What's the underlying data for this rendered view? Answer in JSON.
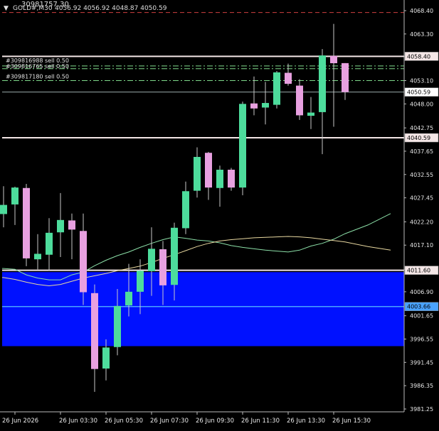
{
  "header": {
    "arrow": "▼",
    "symbol": "GOLD#,M30",
    "ohlc": "4056.92 4056.92 4048.87 4050.59",
    "top_partial": "30981757.30"
  },
  "colors": {
    "background": "#000000",
    "bull_body": "#4ddc9c",
    "bear_body": "#e8a0e0",
    "wick": "#c8c8c8",
    "zone_fill": "#0011ff",
    "ma_short": "#8ce0a8",
    "ma_long": "#e8d8a0",
    "level_white": "#f4e6e6",
    "level_blue": "#4aa3ff",
    "order_line": "#7fd98a",
    "top_dash": "#d04040"
  },
  "order_labels": [
    {
      "text": "#309816988 sell 0.50"
    },
    {
      "text": "#309816765 sell 0.50"
    },
    {
      "text": "#309817180 sell 0.50"
    }
  ],
  "price_boxes": {
    "resistance_upper": "4058.40",
    "current": "4050.59",
    "resistance_lower": "4040.59",
    "support": "4011.60",
    "zone_mid": "4003.66"
  },
  "chart_data": {
    "type": "candlestick",
    "ylim": [
      3981.25,
      4068.4
    ],
    "price_ticks": [
      "4068.40",
      "4063.30",
      "4058.40",
      "4053.10",
      "4048.00",
      "4042.75",
      "4037.65",
      "4032.55",
      "4027.45",
      "4022.20",
      "4017.10",
      "4011.80",
      "4006.90",
      "4001.65",
      "3996.55",
      "3991.45",
      "3986.35",
      "3981.25"
    ],
    "time_labels": [
      {
        "text": "26 Jun 2026",
        "index": 1
      },
      {
        "text": "26 Jun 03:30",
        "index": 5
      },
      {
        "text": "26 Jun 05:30",
        "index": 9
      },
      {
        "text": "26 Jun 07:30",
        "index": 13
      },
      {
        "text": "26 Jun 09:30",
        "index": 17
      },
      {
        "text": "26 Jun 11:30",
        "index": 21
      },
      {
        "text": "26 Jun 13:30",
        "index": 25
      },
      {
        "text": "26 Jun 15:30",
        "index": 29
      }
    ],
    "candles": [
      {
        "o": 4023.9,
        "h": 4030.0,
        "l": 4021.0,
        "c": 4025.9
      },
      {
        "o": 4026.0,
        "h": 4029.9,
        "l": 4021.5,
        "c": 4029.7
      },
      {
        "o": 4029.6,
        "h": 4030.5,
        "l": 4012.5,
        "c": 4014.2
      },
      {
        "o": 4014.0,
        "h": 4019.5,
        "l": 4011.8,
        "c": 4015.2
      },
      {
        "o": 4015.0,
        "h": 4023.0,
        "l": 4011.5,
        "c": 4019.8
      },
      {
        "o": 4019.9,
        "h": 4028.5,
        "l": 4014.5,
        "c": 4022.6
      },
      {
        "o": 4022.5,
        "h": 4024.0,
        "l": 4014.0,
        "c": 4020.5
      },
      {
        "o": 4020.2,
        "h": 4024.0,
        "l": 4004.0,
        "c": 4006.8
      },
      {
        "o": 4006.6,
        "h": 4008.5,
        "l": 3985.0,
        "c": 3990.0
      },
      {
        "o": 3990.1,
        "h": 3996.5,
        "l": 3987.5,
        "c": 3994.7
      },
      {
        "o": 3994.8,
        "h": 4007.5,
        "l": 3993.0,
        "c": 4003.8
      },
      {
        "o": 4003.9,
        "h": 4013.0,
        "l": 4001.5,
        "c": 4006.9
      },
      {
        "o": 4006.9,
        "h": 4014.0,
        "l": 4002.0,
        "c": 4011.5
      },
      {
        "o": 4011.4,
        "h": 4021.0,
        "l": 4006.0,
        "c": 4016.3
      },
      {
        "o": 4016.2,
        "h": 4018.0,
        "l": 4004.0,
        "c": 4008.3
      },
      {
        "o": 4008.4,
        "h": 4022.0,
        "l": 4005.0,
        "c": 4020.9
      },
      {
        "o": 4020.8,
        "h": 4031.0,
        "l": 4019.5,
        "c": 4028.9
      },
      {
        "o": 4029.0,
        "h": 4038.5,
        "l": 4027.5,
        "c": 4036.4
      },
      {
        "o": 4037.3,
        "h": 4037.5,
        "l": 4027.0,
        "c": 4029.7
      },
      {
        "o": 4029.6,
        "h": 4034.5,
        "l": 4025.5,
        "c": 4033.6
      },
      {
        "o": 4033.6,
        "h": 4034.0,
        "l": 4029.0,
        "c": 4029.7
      },
      {
        "o": 4029.7,
        "h": 4048.5,
        "l": 4028.0,
        "c": 4048.0
      },
      {
        "o": 4048.1,
        "h": 4054.0,
        "l": 4045.5,
        "c": 4047.0
      },
      {
        "o": 4047.2,
        "h": 4052.8,
        "l": 4043.5,
        "c": 4048.2
      },
      {
        "o": 4047.8,
        "h": 4055.2,
        "l": 4047.0,
        "c": 4054.9
      },
      {
        "o": 4054.8,
        "h": 4056.8,
        "l": 4052.0,
        "c": 4052.4
      },
      {
        "o": 4052.0,
        "h": 4053.4,
        "l": 4044.5,
        "c": 4045.5
      },
      {
        "o": 4045.4,
        "h": 4049.5,
        "l": 4042.5,
        "c": 4046.1
      },
      {
        "o": 4046.2,
        "h": 4060.0,
        "l": 4037.0,
        "c": 4058.6
      },
      {
        "o": 4058.5,
        "h": 4065.5,
        "l": 4043.0,
        "c": 4056.9
      },
      {
        "o": 4056.92,
        "h": 4056.92,
        "l": 4048.87,
        "c": 4050.59
      }
    ],
    "ma_short": [
      4012.0,
      4011.8,
      4010.6,
      4009.9,
      4009.5,
      4009.5,
      4010.6,
      4011.2,
      4012.6,
      4013.8,
      4014.8,
      4015.6,
      4016.6,
      4017.5,
      4018.3,
      4018.9,
      4018.6,
      4018.2,
      4018.0,
      4017.6,
      4017.0,
      4016.6,
      4016.3,
      4016.0,
      4015.8,
      4015.6,
      4016.0,
      4016.9,
      4017.5,
      4018.4,
      4019.6
    ],
    "ma_long": [
      4010.0,
      4009.6,
      4009.0,
      4008.5,
      4008.2,
      4008.5,
      4009.2,
      4009.9,
      4010.4,
      4010.9,
      4011.5,
      4012.0,
      4012.5,
      4013.3,
      4014.2,
      4015.0,
      4015.9,
      4016.8,
      4017.5,
      4018.0,
      4018.3,
      4018.5,
      4018.7,
      4018.8,
      4018.9,
      4019.0,
      4018.9,
      4018.7,
      4018.4,
      4018.1,
      4017.8
    ],
    "ma_short_tail": [
      {
        "i": 30,
        "v": 4019.6
      },
      {
        "i": 32,
        "v": 4021.5
      },
      {
        "i": 34,
        "v": 4024.0
      }
    ],
    "ma_long_tail": [
      {
        "i": 30,
        "v": 4017.8
      },
      {
        "i": 32,
        "v": 4016.8
      },
      {
        "i": 34,
        "v": 4016.0
      }
    ],
    "levels": {
      "resistance_upper": 4058.4,
      "resistance_lower": 4040.59,
      "current": 4050.59,
      "support": 4011.6,
      "zone_mid": 4003.66,
      "zone_top": 4011.2,
      "zone_bottom": 3995.0,
      "order_lines": [
        4056.3,
        4055.7,
        4053.1
      ],
      "top_dash": 4068.0
    }
  }
}
